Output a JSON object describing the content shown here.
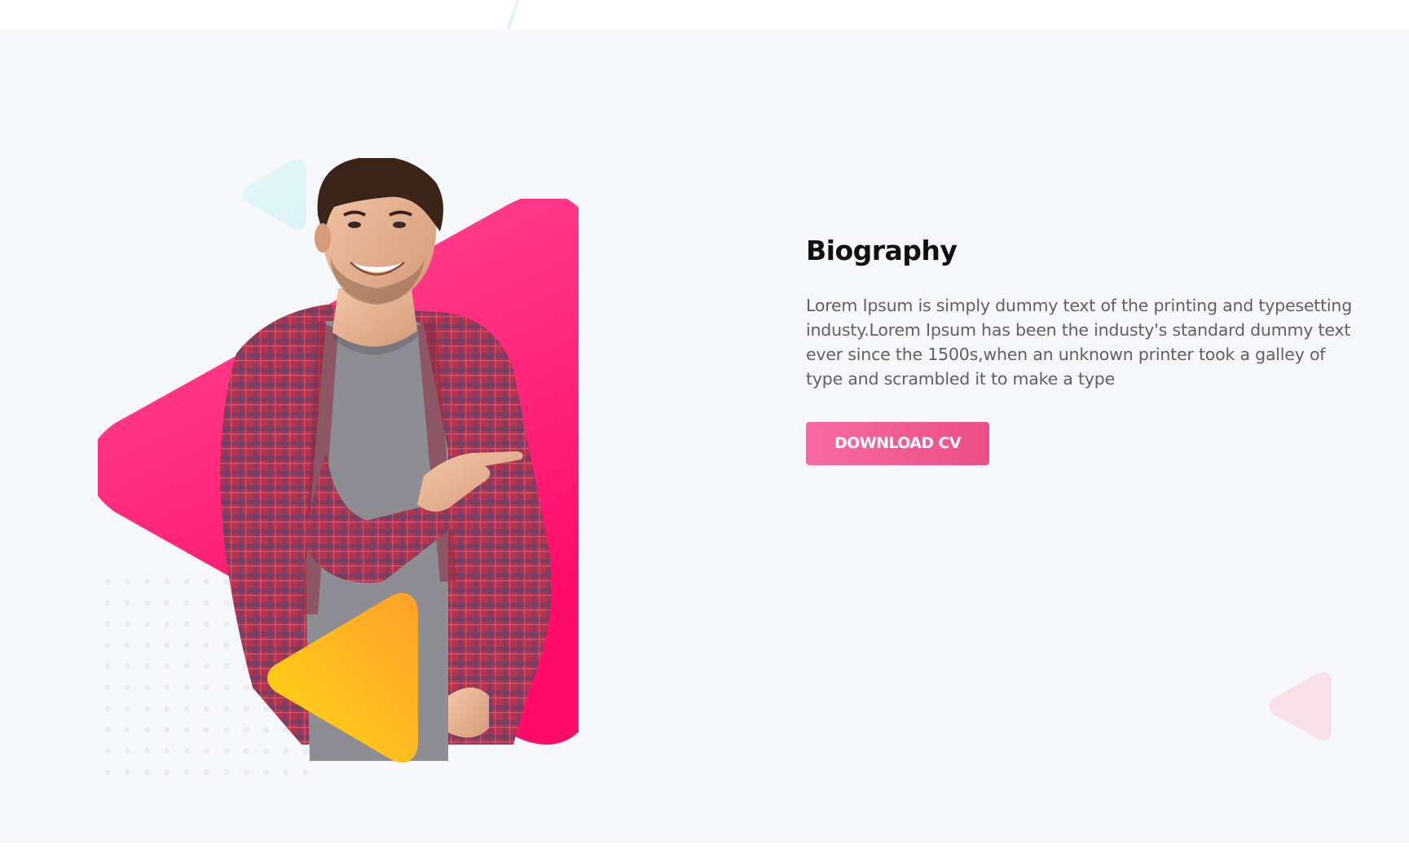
{
  "biography": {
    "title": "Biography",
    "text": "Lorem Ipsum is simply dummy text of the printing and typesetting industy.Lorem Ipsum has been the industy's standard dummy text ever since the 1500s,when an unknown printer took a galley of type and scrambled it to make a type",
    "download_label": "DOWNLOAD CV"
  },
  "colors": {
    "background": "#f7f8fb",
    "pink_accent": "#ff2b7f",
    "yellow_accent": "#ffc31f",
    "button_start": "#f96aa3",
    "button_end": "#ec4d86",
    "title_text": "#111111",
    "body_text": "#5f5f66"
  },
  "image": {
    "subject": "smiling man in plaid shirt pointing right"
  }
}
